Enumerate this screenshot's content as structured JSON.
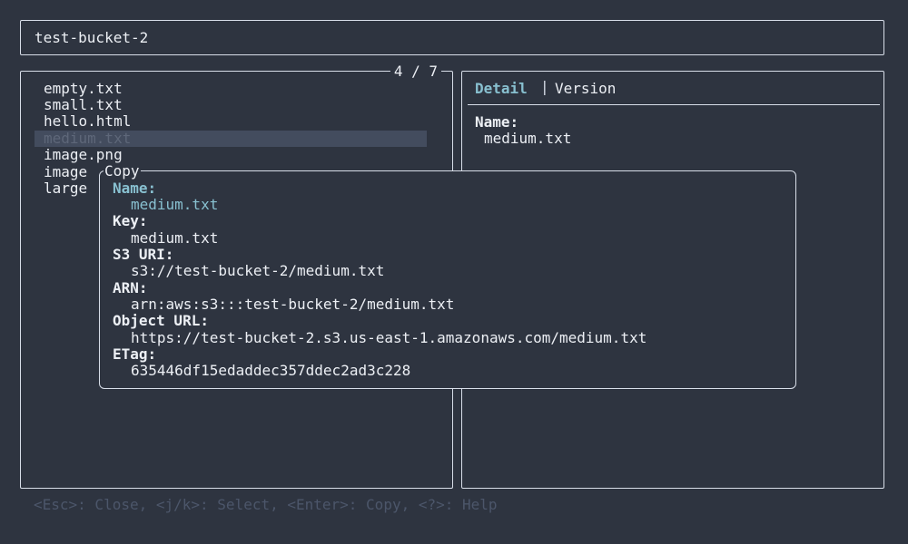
{
  "header": {
    "title": "test-bucket-2"
  },
  "list": {
    "counter": "4 / 7",
    "items": [
      "empty.txt",
      "small.txt",
      "hello.html",
      "medium.txt",
      "image.png",
      "image",
      "large"
    ],
    "selected_index": 3
  },
  "detail": {
    "tabs": {
      "active": "Detail",
      "separator": "|",
      "inactive": "Version"
    },
    "name_label": "Name:",
    "name_value": "medium.txt"
  },
  "copy_dialog": {
    "title": "Copy",
    "fields": [
      {
        "label": "Name:",
        "value": "medium.txt"
      },
      {
        "label": "Key:",
        "value": "medium.txt"
      },
      {
        "label": "S3 URI:",
        "value": "s3://test-bucket-2/medium.txt"
      },
      {
        "label": "ARN:",
        "value": "arn:aws:s3:::test-bucket-2/medium.txt"
      },
      {
        "label": "Object URL:",
        "value": "https://test-bucket-2.s3.us-east-1.amazonaws.com/medium.txt"
      },
      {
        "label": "ETag:",
        "value": "635446df15edaddec357ddec2ad3c228"
      }
    ],
    "selected_index": 0
  },
  "footer": {
    "help": "<Esc>: Close, <j/k>: Select, <Enter>: Copy, <?>: Help"
  },
  "colors": {
    "background": "#2e3440",
    "foreground": "#eceff4",
    "accent": "#88c0d0",
    "selection_bg": "#434c5e",
    "muted": "#4c566a"
  }
}
